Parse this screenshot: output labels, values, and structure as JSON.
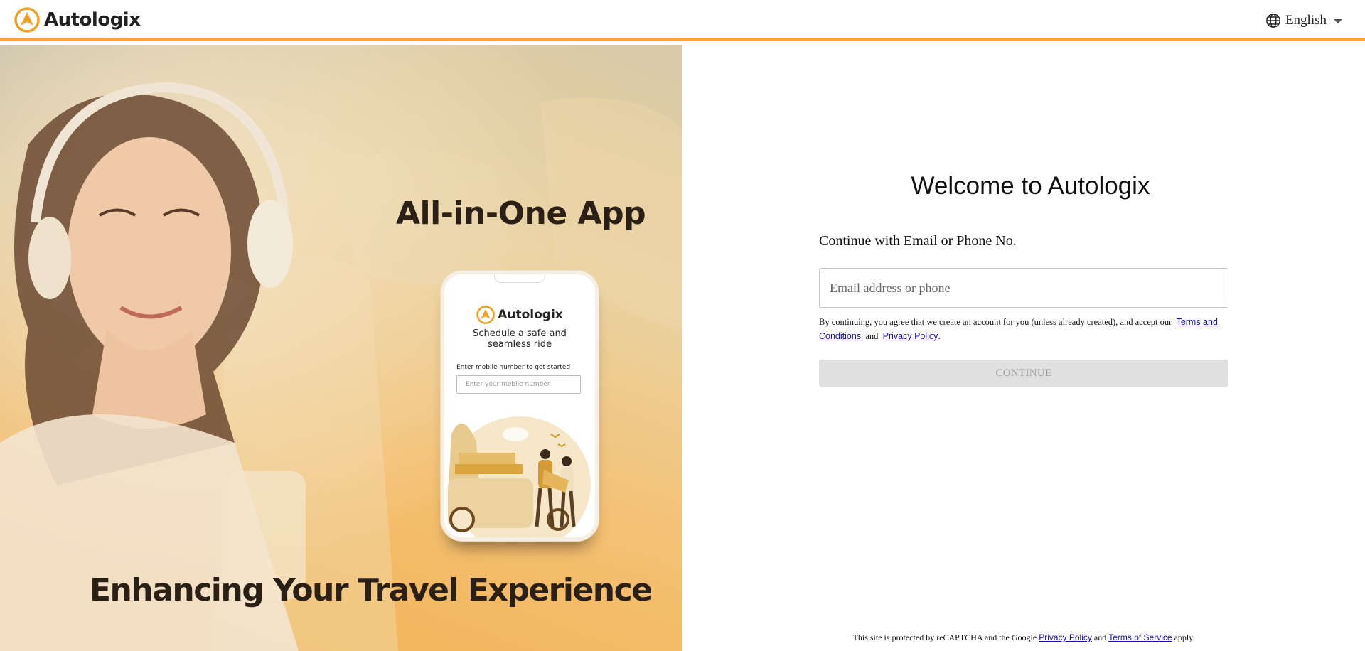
{
  "header": {
    "brand_name": "Autologix",
    "language": "English"
  },
  "hero": {
    "title": "All-in-One App",
    "tagline": "Enhancing Your Travel Experience",
    "phone": {
      "brand_name": "Autologix",
      "subtitle": "Schedule a safe and seamless ride",
      "input_label": "Enter mobile number to get started",
      "input_placeholder": "Enter your mobile number"
    }
  },
  "login": {
    "welcome": "Welcome to Autologix",
    "continue_label": "Continue with Email or Phone No.",
    "email_placeholder": "Email address or phone",
    "consent_text": "By continuing, you agree that we create an account for you (unless already created), and accept our",
    "terms_link": "Terms and Conditions",
    "and_text": "and",
    "privacy_link": "Privacy Policy",
    "period": ".",
    "continue_button": "CONTINUE"
  },
  "footer": {
    "text_before": "This site is protected by reCAPTCHA and the Google",
    "privacy_link": "Privacy Policy",
    "and_text": "and",
    "terms_link": "Terms of Service",
    "text_after": "apply."
  },
  "colors": {
    "accent": "#f0a830",
    "button_disabled": "#e0e0e0",
    "link": "#1a0dab"
  },
  "icons": {
    "logo": "autologix-logo-icon",
    "language": "globe-icon",
    "dropdown": "chevron-down-icon"
  }
}
